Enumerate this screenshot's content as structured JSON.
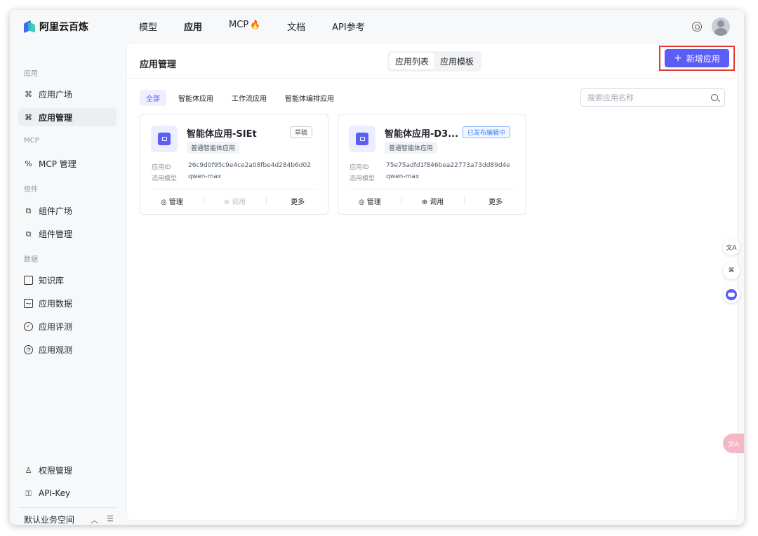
{
  "brand": {
    "name": "阿里云百炼"
  },
  "nav": [
    "模型",
    "应用",
    "MCP",
    "文档",
    "API参考"
  ],
  "nav_active": "应用",
  "sidebar": {
    "sections": [
      {
        "title": "应用",
        "items": [
          "应用广场",
          "应用管理"
        ]
      },
      {
        "title": "MCP",
        "items": [
          "MCP 管理"
        ]
      },
      {
        "title": "组件",
        "items": [
          "组件广场",
          "组件管理"
        ]
      },
      {
        "title": "数据",
        "items": [
          "知识库",
          "应用数据",
          "应用评测",
          "应用观测"
        ]
      }
    ],
    "active_item": "应用管理",
    "bottom_items": [
      "权限管理",
      "API-Key"
    ],
    "workspace": "默认业务空间"
  },
  "page": {
    "title": "应用管理",
    "segments": [
      "应用列表",
      "应用模板"
    ],
    "active_segment": "应用列表",
    "new_button": "新增应用",
    "filters": [
      "全部",
      "智能体应用",
      "工作流应用",
      "智能体编排应用"
    ],
    "active_filter": "全部",
    "search_placeholder": "搜索应用名称"
  },
  "cards": [
    {
      "title": "智能体应用-SIEt",
      "badge": "草稿",
      "subtitle": "普通智能体应用",
      "app_id_label": "应用ID",
      "app_id": "26c9d0f95c9e4ce2a08fbe4d284b6d02",
      "model_label": "选用模型",
      "model": "qwen-max",
      "actions": [
        "管理",
        "调用",
        "更多"
      ]
    },
    {
      "title": "智能体应用-D3...",
      "badge": "已发布编辑中",
      "subtitle": "普通智能体应用",
      "app_id_label": "应用ID",
      "app_id": "75e75adfd1f846bea22773a73dd89d4e",
      "model_label": "选用模型",
      "model": "qwen-max",
      "actions": [
        "管理",
        "调用",
        "更多"
      ]
    }
  ],
  "colors": {
    "primary": "#5b5ef5",
    "highlight_border": "#e53935"
  }
}
